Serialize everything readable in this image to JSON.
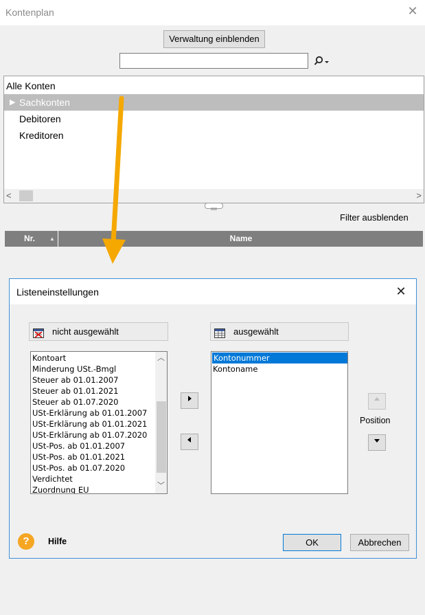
{
  "window": {
    "title": "Kontenplan",
    "close_glyph": "✕"
  },
  "toolbar": {
    "show_admin_label": "Verwaltung einblenden",
    "search_value": "",
    "search_icon": "search-icon"
  },
  "tree": {
    "root": "Alle Konten",
    "items": [
      {
        "label": "Sachkonten",
        "selected": true
      },
      {
        "label": "Debitoren",
        "selected": false
      },
      {
        "label": "Kreditoren",
        "selected": false
      }
    ]
  },
  "filter": {
    "hide_label": "Filter ausblenden"
  },
  "grid": {
    "columns": [
      "Nr.",
      "Name"
    ]
  },
  "dialog": {
    "title": "Listeneinstellungen",
    "close_glyph": "✕",
    "not_selected_header": "nicht ausgewählt",
    "selected_header": "ausgewählt",
    "not_selected_items": [
      "Kontoart",
      "Minderung USt.-Bmgl",
      "Steuer ab 01.01.2007",
      "Steuer ab 01.01.2021",
      "Steuer ab 01.07.2020",
      "USt-Erklärung ab 01.01.2007",
      "USt-Erklärung ab 01.01.2021",
      "USt-Erklärung ab 01.07.2020",
      "USt-Pos. ab 01.01.2007",
      "USt-Pos. ab 01.01.2021",
      "USt-Pos. ab 01.07.2020",
      "Verdichtet",
      "Zuordnung EU"
    ],
    "selected_items": [
      {
        "label": "Kontonummer",
        "selected": true
      },
      {
        "label": "Kontoname",
        "selected": false
      }
    ],
    "position_label": "Position",
    "help_label": "Hilfe",
    "ok_label": "OK",
    "cancel_label": "Abbrechen"
  },
  "colors": {
    "selection": "#0078d7",
    "tree_selected": "#bdbdbd",
    "grid_header": "#7f7f7f",
    "annotation_arrow": "#f5a800",
    "help_icon": "#f5a623"
  }
}
